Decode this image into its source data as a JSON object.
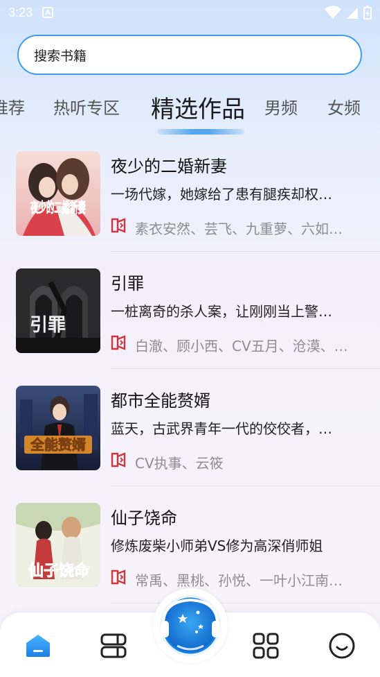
{
  "status_bar": {
    "time": "3:23",
    "notification_letter": "A"
  },
  "search": {
    "placeholder": "搜索书籍"
  },
  "tabs": [
    {
      "label": "推荐"
    },
    {
      "label": "热听专区"
    },
    {
      "label": "精选作品",
      "active": true
    },
    {
      "label": "男频"
    },
    {
      "label": "女频"
    }
  ],
  "books": [
    {
      "title": "夜少的二婚新妻",
      "description": "一场代嫁，她嫁给了患有腿疾却权…",
      "authors": "素衣安然、芸飞、九重萝、六如…",
      "cover_text": "夜少的二婚新妻",
      "cover_colors": [
        "#f2c9c4",
        "#e39b9b",
        "#c7504f"
      ]
    },
    {
      "title": "引罪",
      "description": "一桩离奇的杀人案，让刚刚当上警…",
      "authors": "白澈、顾小西、CV五月、沧漠、…",
      "cover_text": "引罪",
      "cover_colors": [
        "#3b3b3e",
        "#1c1b1e",
        "#6a2a2a"
      ]
    },
    {
      "title": "都市全能赘婿",
      "description": "蓝天，古武界青年一代的佼佼者，…",
      "authors": "CV执事、云筱",
      "cover_text": "全能赘婿",
      "cover_colors": [
        "#2d3d63",
        "#1b2440",
        "#d98e2b"
      ]
    },
    {
      "title": "仙子饶命",
      "description": "修炼废柴小师弟VS修为高深俏师姐",
      "authors": "常禹、黑桃、孙悦、一叶小江南…",
      "cover_text": "仙子饶命",
      "cover_colors": [
        "#eef0e6",
        "#c9d7b7",
        "#b3262b"
      ]
    }
  ],
  "accent_color": "#3d9cf1",
  "author_icon_color": "#d2353d",
  "nav": [
    {
      "name": "home-icon"
    },
    {
      "name": "bookshelf-icon"
    },
    {
      "name": "player-icon"
    },
    {
      "name": "category-icon"
    },
    {
      "name": "profile-icon"
    }
  ]
}
